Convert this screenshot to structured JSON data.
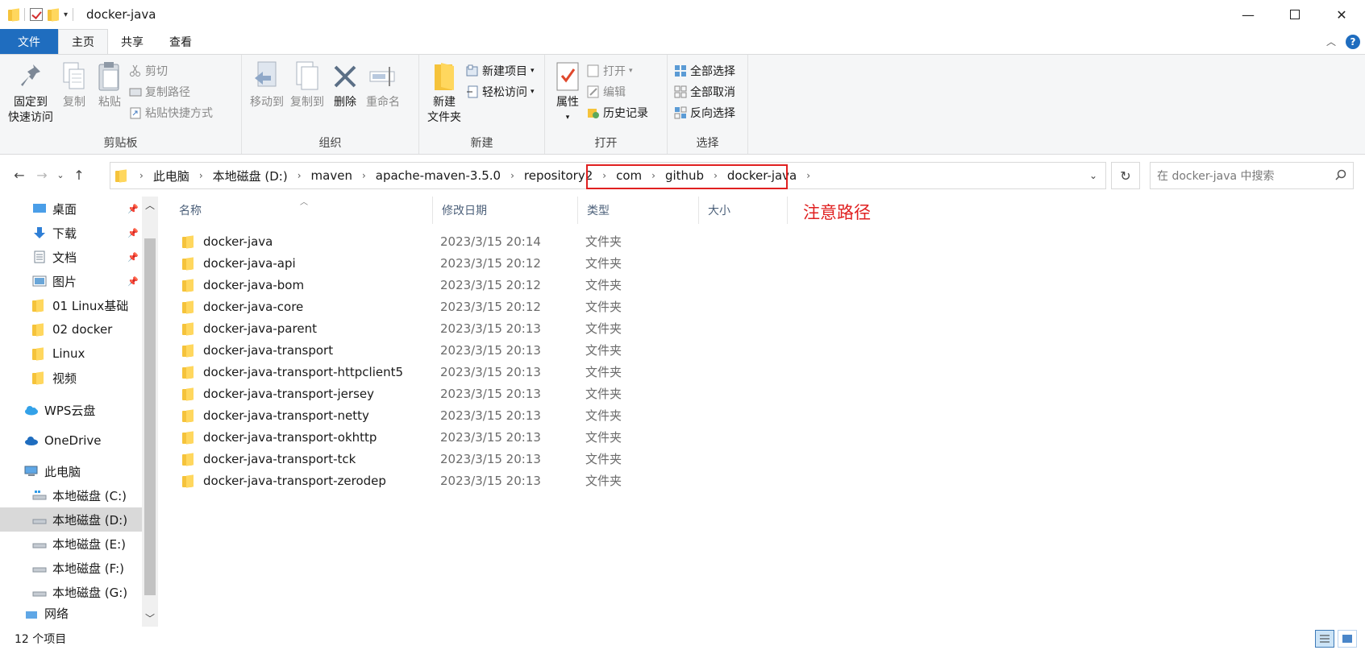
{
  "window": {
    "title": "docker-java",
    "minimize": "—",
    "close": "✕"
  },
  "ribbon_tabs": [
    "文件",
    "主页",
    "共享",
    "查看"
  ],
  "ribbon": {
    "clipboard": {
      "label": "剪贴板",
      "pin": "固定到\n快速访问",
      "pin_line1": "固定到",
      "pin_line2": "快速访问",
      "copy": "复制",
      "paste": "粘贴",
      "cut": "剪切",
      "copy_path": "复制路径",
      "paste_shortcut": "粘贴快捷方式"
    },
    "organize": {
      "label": "组织",
      "move_to": "移动到",
      "copy_to": "复制到",
      "delete": "删除",
      "rename": "重命名"
    },
    "new": {
      "label": "新建",
      "new_folder_line1": "新建",
      "new_folder_line2": "文件夹",
      "new_item": "新建项目",
      "easy_access": "轻松访问"
    },
    "open": {
      "label": "打开",
      "properties": "属性",
      "open": "打开",
      "edit": "编辑",
      "history": "历史记录"
    },
    "select": {
      "label": "选择",
      "select_all": "全部选择",
      "select_none": "全部取消",
      "invert": "反向选择"
    }
  },
  "address": {
    "breadcrumbs": [
      "此电脑",
      "本地磁盘 (D:)",
      "maven",
      "apache-maven-3.5.0",
      "repository2",
      "com",
      "github",
      "docker-java"
    ],
    "search_placeholder": "在 docker-java 中搜索"
  },
  "annotation": {
    "note": "注意路径",
    "color": "#e02020"
  },
  "nav": {
    "items": [
      {
        "label": "桌面",
        "icon": "desktop-icon",
        "pinned": true
      },
      {
        "label": "下载",
        "icon": "download-icon",
        "pinned": true
      },
      {
        "label": "文档",
        "icon": "document-icon",
        "pinned": true
      },
      {
        "label": "图片",
        "icon": "picture-icon",
        "pinned": true
      },
      {
        "label": "01 Linux基础",
        "icon": "folder-icon",
        "pinned": false
      },
      {
        "label": "02 docker",
        "icon": "folder-icon",
        "pinned": false
      },
      {
        "label": "Linux",
        "icon": "folder-icon",
        "pinned": false
      },
      {
        "label": "视频",
        "icon": "folder-icon",
        "pinned": false
      }
    ],
    "wps": "WPS云盘",
    "onedrive": "OneDrive",
    "this_pc": "此电脑",
    "drives": [
      "本地磁盘 (C:)",
      "本地磁盘 (D:)",
      "本地磁盘 (E:)",
      "本地磁盘 (F:)",
      "本地磁盘 (G:)"
    ],
    "network": "网络"
  },
  "columns": {
    "name": "名称",
    "date": "修改日期",
    "type": "类型",
    "size": "大小"
  },
  "files": [
    {
      "name": "docker-java",
      "date": "2023/3/15 20:14",
      "type": "文件夹"
    },
    {
      "name": "docker-java-api",
      "date": "2023/3/15 20:12",
      "type": "文件夹"
    },
    {
      "name": "docker-java-bom",
      "date": "2023/3/15 20:12",
      "type": "文件夹"
    },
    {
      "name": "docker-java-core",
      "date": "2023/3/15 20:12",
      "type": "文件夹"
    },
    {
      "name": "docker-java-parent",
      "date": "2023/3/15 20:13",
      "type": "文件夹"
    },
    {
      "name": "docker-java-transport",
      "date": "2023/3/15 20:13",
      "type": "文件夹"
    },
    {
      "name": "docker-java-transport-httpclient5",
      "date": "2023/3/15 20:13",
      "type": "文件夹"
    },
    {
      "name": "docker-java-transport-jersey",
      "date": "2023/3/15 20:13",
      "type": "文件夹"
    },
    {
      "name": "docker-java-transport-netty",
      "date": "2023/3/15 20:13",
      "type": "文件夹"
    },
    {
      "name": "docker-java-transport-okhttp",
      "date": "2023/3/15 20:13",
      "type": "文件夹"
    },
    {
      "name": "docker-java-transport-tck",
      "date": "2023/3/15 20:13",
      "type": "文件夹"
    },
    {
      "name": "docker-java-transport-zerodep",
      "date": "2023/3/15 20:13",
      "type": "文件夹"
    }
  ],
  "status": {
    "count": "12 个项目"
  },
  "colors": {
    "accent": "#1f6dbf",
    "folder": "#f5c33b",
    "selected": "#d9d9d9"
  }
}
